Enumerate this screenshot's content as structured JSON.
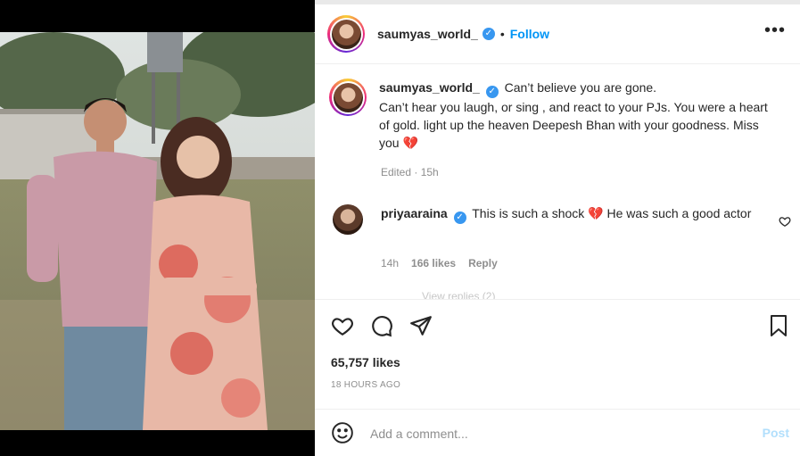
{
  "post": {
    "username": "saumyas_world_",
    "follow_label": "Follow",
    "more_label": "•••",
    "caption_lines": [
      "Can’t believe you are gone.",
      "Can’t hear you laugh, or sing , and react to your PJs. You were a heart of gold. light up the heaven Deepesh Bhan with your goodness. Miss you 💔"
    ],
    "caption_meta": "Edited · 15h",
    "likes": "65,757 likes",
    "timestamp": "18 HOURS AGO"
  },
  "comment": {
    "username": "priyaaraina",
    "text": "This is such a shock 💔  He was such a good actor",
    "time": "14h",
    "likes": "166 likes",
    "reply_label": "Reply",
    "cut_text": "View replies (2)"
  },
  "add_comment": {
    "emoji_icon": "emoji-icon",
    "placeholder": "Add a comment...",
    "post_label": "Post"
  },
  "colors": {
    "accent": "#0095f6",
    "post_disabled": "#b2dffc",
    "verified": "#3897f0"
  },
  "icons": {
    "like": "heart-icon",
    "comment": "comment-icon",
    "share": "share-icon",
    "save": "bookmark-icon",
    "more": "more-options-icon"
  }
}
